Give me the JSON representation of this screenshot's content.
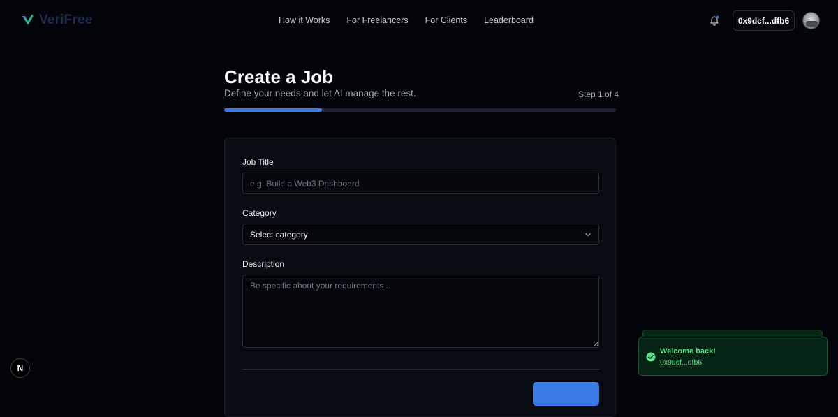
{
  "app": {
    "logo_text": "VeriFree",
    "brand_color": "#3b7be8"
  },
  "nav": {
    "links": [
      {
        "label": "How it Works"
      },
      {
        "label": "For Freelancers"
      },
      {
        "label": "For Clients"
      },
      {
        "label": "Leaderboard"
      }
    ],
    "notification_icon": "bell-icon",
    "wallet_label": "0x9dcf...dfb6",
    "avatar_icon": "avatar"
  },
  "header": {
    "title": "Create a Job",
    "subtitle": "Define your needs and let AI manage the rest.",
    "step_text": "Step 1 of 4",
    "progress_fraction": 0.25
  },
  "form": {
    "job_title": {
      "label": "Job Title",
      "placeholder": "e.g. Build a Web3 Dashboard",
      "value": ""
    },
    "category": {
      "label": "Category",
      "selected": "Select category",
      "icon": "chevron-down-icon"
    },
    "description": {
      "label": "Description",
      "placeholder": "Be specific about your requirements...",
      "value": ""
    }
  },
  "dev_badge": {
    "label": "N"
  },
  "toast": {
    "title": "Welcome back!",
    "subtitle": "0x9dcf...dfb6",
    "icon": "check-circle-icon",
    "color": "#59e38a"
  }
}
